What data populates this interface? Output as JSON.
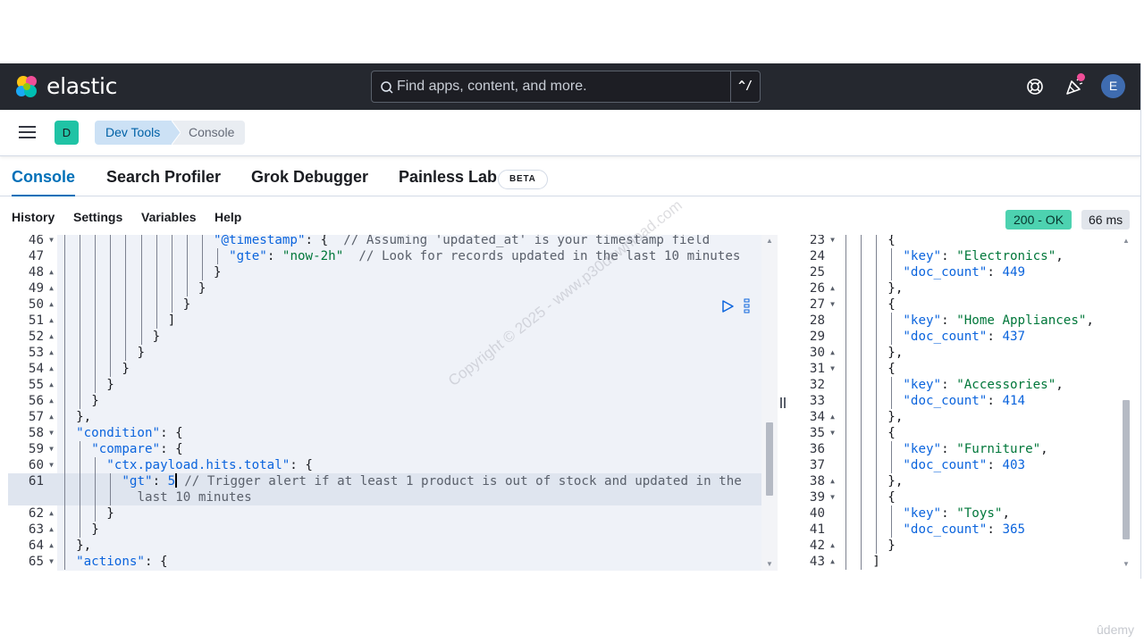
{
  "header": {
    "brand": "elastic",
    "search_placeholder": "Find apps, content, and more.",
    "search_shortcut": "^/",
    "user_initial": "E"
  },
  "breadcrumbs": {
    "space_initial": "D",
    "items": [
      "Dev Tools",
      "Console"
    ]
  },
  "tabs": [
    {
      "label": "Console",
      "active": true
    },
    {
      "label": "Search Profiler",
      "active": false
    },
    {
      "label": "Grok Debugger",
      "active": false
    },
    {
      "label": "Painless Lab",
      "active": false
    }
  ],
  "beta_badge": "BETA",
  "toolbar": {
    "links": [
      "History",
      "Settings",
      "Variables",
      "Help"
    ],
    "status": "200 - OK",
    "duration": "66 ms"
  },
  "request_editor": {
    "lines": [
      {
        "no": "46",
        "fold": "down",
        "indent": 10,
        "text": "\"@timestamp\": {  // Assuming 'updated_at' is your timestamp field"
      },
      {
        "no": "47",
        "fold": "",
        "indent": 11,
        "text": "\"gte\": \"now-2h\"  // Look for records updated in the last 10 minutes"
      },
      {
        "no": "48",
        "fold": "up",
        "indent": 10,
        "text": "}"
      },
      {
        "no": "49",
        "fold": "up",
        "indent": 9,
        "text": "}"
      },
      {
        "no": "50",
        "fold": "up",
        "indent": 8,
        "text": "}"
      },
      {
        "no": "51",
        "fold": "up",
        "indent": 7,
        "text": "]"
      },
      {
        "no": "52",
        "fold": "up",
        "indent": 6,
        "text": "}"
      },
      {
        "no": "53",
        "fold": "up",
        "indent": 5,
        "text": "}"
      },
      {
        "no": "54",
        "fold": "up",
        "indent": 4,
        "text": "}"
      },
      {
        "no": "55",
        "fold": "up",
        "indent": 3,
        "text": "}"
      },
      {
        "no": "56",
        "fold": "up",
        "indent": 2,
        "text": "}"
      },
      {
        "no": "57",
        "fold": "up",
        "indent": 1,
        "text": "},"
      },
      {
        "no": "58",
        "fold": "down",
        "indent": 1,
        "text": "\"condition\": {"
      },
      {
        "no": "59",
        "fold": "down",
        "indent": 2,
        "text": "\"compare\": {"
      },
      {
        "no": "60",
        "fold": "down",
        "indent": 3,
        "text": "\"ctx.payload.hits.total\": {"
      },
      {
        "no": "61",
        "fold": "",
        "indent": 4,
        "text": "\"gt\": 5",
        "cursor": true,
        "comment": " // Trigger alert if at least 1 product is out of stock and updated in the",
        "wrap": "last 10 minutes"
      },
      {
        "no": "62",
        "fold": "up",
        "indent": 3,
        "text": "}"
      },
      {
        "no": "63",
        "fold": "up",
        "indent": 2,
        "text": "}"
      },
      {
        "no": "64",
        "fold": "up",
        "indent": 1,
        "text": "},"
      },
      {
        "no": "65",
        "fold": "down",
        "indent": 1,
        "text": "\"actions\": {"
      }
    ]
  },
  "response_editor": {
    "lines": [
      {
        "no": "23",
        "fold": "down",
        "indent": 3,
        "text": "{"
      },
      {
        "no": "24",
        "fold": "",
        "indent": 4,
        "text": "\"key\": \"Electronics\","
      },
      {
        "no": "25",
        "fold": "",
        "indent": 4,
        "text": "\"doc_count\": 449"
      },
      {
        "no": "26",
        "fold": "up",
        "indent": 3,
        "text": "},"
      },
      {
        "no": "27",
        "fold": "down",
        "indent": 3,
        "text": "{"
      },
      {
        "no": "28",
        "fold": "",
        "indent": 4,
        "text": "\"key\": \"Home Appliances\","
      },
      {
        "no": "29",
        "fold": "",
        "indent": 4,
        "text": "\"doc_count\": 437"
      },
      {
        "no": "30",
        "fold": "up",
        "indent": 3,
        "text": "},"
      },
      {
        "no": "31",
        "fold": "down",
        "indent": 3,
        "text": "{"
      },
      {
        "no": "32",
        "fold": "",
        "indent": 4,
        "text": "\"key\": \"Accessories\","
      },
      {
        "no": "33",
        "fold": "",
        "indent": 4,
        "text": "\"doc_count\": 414"
      },
      {
        "no": "34",
        "fold": "up",
        "indent": 3,
        "text": "},"
      },
      {
        "no": "35",
        "fold": "down",
        "indent": 3,
        "text": "{"
      },
      {
        "no": "36",
        "fold": "",
        "indent": 4,
        "text": "\"key\": \"Furniture\","
      },
      {
        "no": "37",
        "fold": "",
        "indent": 4,
        "text": "\"doc_count\": 403"
      },
      {
        "no": "38",
        "fold": "up",
        "indent": 3,
        "text": "},"
      },
      {
        "no": "39",
        "fold": "down",
        "indent": 3,
        "text": "{"
      },
      {
        "no": "40",
        "fold": "",
        "indent": 4,
        "text": "\"key\": \"Toys\","
      },
      {
        "no": "41",
        "fold": "",
        "indent": 4,
        "text": "\"doc_count\": 365"
      },
      {
        "no": "42",
        "fold": "up",
        "indent": 3,
        "text": "}"
      },
      {
        "no": "43",
        "fold": "up",
        "indent": 2,
        "text": "]"
      }
    ]
  },
  "watermark": "Copyright © 2025 - www.p30download.com",
  "udemy_mark": "ûdemy",
  "colors": {
    "header_bg": "#25282f",
    "accent": "#0070b8",
    "status_ok": "#4dd2b0",
    "space_avatar": "#20c3a5",
    "user_avatar": "#3f6cb0"
  }
}
